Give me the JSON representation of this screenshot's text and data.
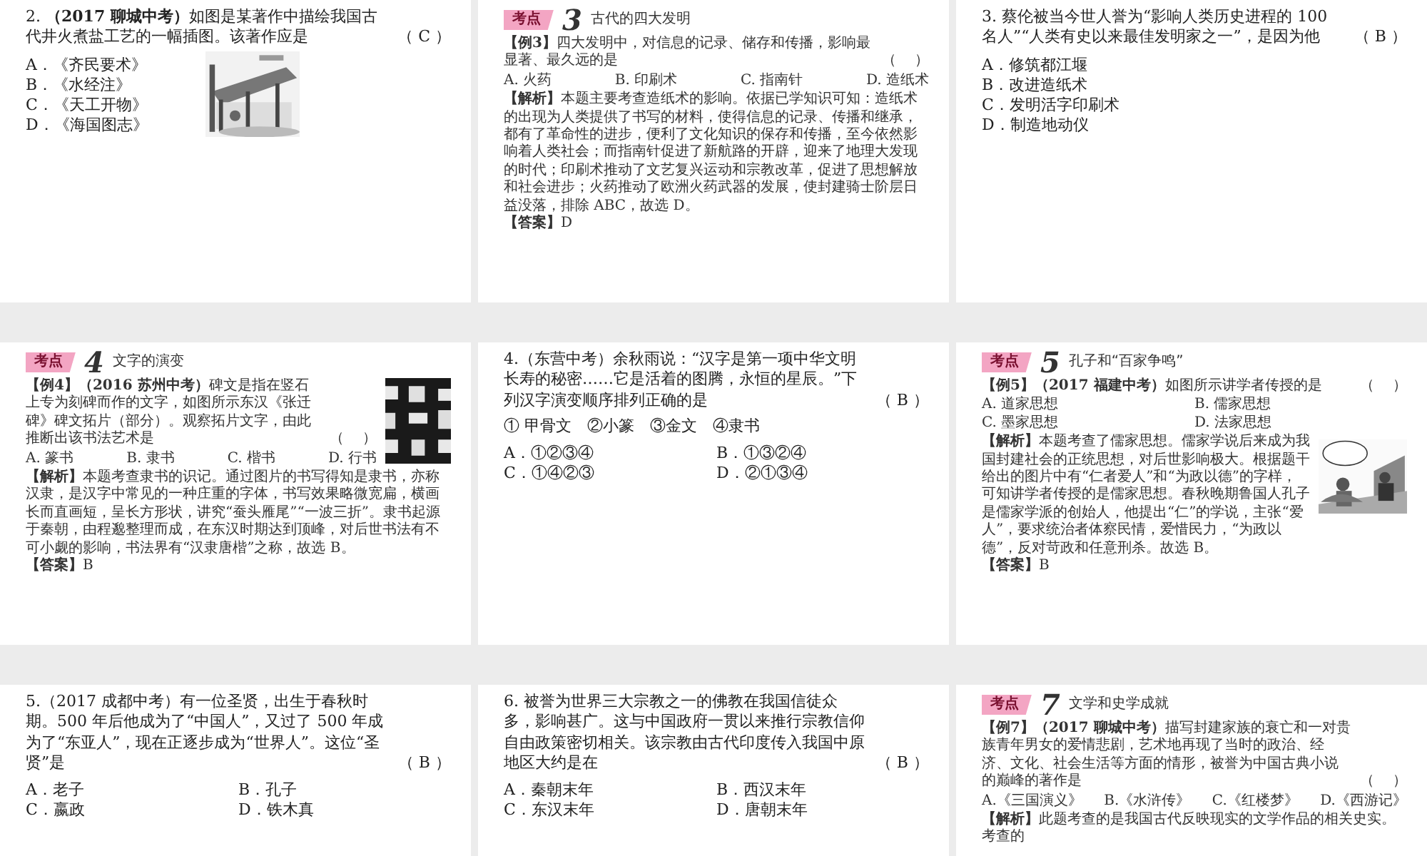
{
  "slides": [
    {
      "kind": "question",
      "selected": false,
      "stem": "2. **（2017 聊城中考）**如图是某著作中描绘我国古代井火煮盐工艺的一幅插图。该著作应是",
      "blank": "（ C ）",
      "options": [
        "A．《齐民要术》",
        "B．《水经注》",
        "C．《天工开物》",
        "D．《海国图志》"
      ]
    },
    {
      "kind": "example",
      "selected": false,
      "topic_label": "考点",
      "topic_number": "3",
      "topic_title": "古代的四大发明",
      "question": "**【例3】**四大发明中，对信息的记录、储存和传播，影响最显著、最久远的是",
      "blank": "（　 ）",
      "options_inline": true,
      "options": [
        "A. 火药",
        "B. 印刷术",
        "C. 指南针",
        "D. 造纸术"
      ],
      "analysis": "**【解析】**本题主要考查造纸术的影响。依据已学知识可知：造纸术的出现为人类提供了书写的材料，使得信息的记录、传播和继承，都有了革命性的进步，便利了文化知识的保存和传播，至今依然影响着人类社会；而指南针促进了新航路的开辟，迎来了地理大发现的时代；印刷术推动了文艺复兴运动和宗教改革，促进了思想解放和社会进步；火药推动了欧洲火药武器的发展，使封建骑士阶层日益没落，排除 ABC，故选 D。",
      "answer": "**【答案】**D"
    },
    {
      "kind": "question",
      "selected": false,
      "stem": "3. 蔡伦被当今世人誉为“影响人类历史进程的 100 名人”“人类有史以来最佳发明家之一”，是因为他",
      "blank": "（ B ）",
      "options": [
        "A．修筑都江堰",
        "B．改进造纸术",
        "C．发明活字印刷术",
        "D．制造地动仪"
      ]
    },
    {
      "kind": "example",
      "selected": false,
      "topic_label": "考点",
      "topic_number": "4",
      "topic_title": "文字的演变",
      "question": "**【例4】（2016 苏州中考）**碑文是指在竖石上专为刻碑而作的文字，如图所示东汉《张迁碑》碑文拓片（部分）。观察拓片文字，由此推断出该书法艺术是",
      "blank": "（　 ）",
      "options_inline": true,
      "options": [
        "A. 篆书",
        "B. 隶书",
        "C. 楷书",
        "D. 行书"
      ],
      "analysis": "**【解析】**本题考查隶书的识记。通过图片的书写得知是隶书，亦称汉隶，是汉字中常见的一种庄重的字体，书写效果略微宽扁，横画长而直画短，呈长方形状，讲究“蚕头雁尾”“一波三折”。隶书起源于秦朝，由程邈整理而成，在东汉时期达到顶峰，对后世书法有不可小觑的影响，书法界有“汉隶唐楷”之称，故选 B。",
      "answer": "**【答案】**B"
    },
    {
      "kind": "question",
      "selected": false,
      "stem": "4.（东营中考）余秋雨说：“汉字是第一项中华文明长寿的秘密……它是活着的图腾，永恒的星辰。”下列汉字演变顺序排列正确的是",
      "blank": "（ B ）",
      "extra": "① 甲骨文　②小篆　③金文　④隶书",
      "options_paired": true,
      "options": [
        "A．①②③④",
        "B．①③②④",
        "C．①④②③",
        "D．②①③④"
      ]
    },
    {
      "kind": "example",
      "selected": false,
      "topic_label": "考点",
      "topic_number": "5",
      "topic_title": "孔子和“百家争鸣”",
      "question": "**【例5】（2017 福建中考）**如图所示讲学者传授的是",
      "blank": "（　 ）",
      "options_paired": true,
      "options": [
        "A. 道家思想",
        "B. 儒家思想",
        "C. 墨家思想",
        "D. 法家思想"
      ],
      "analysis": "**【解析】**本题考查了儒家思想。儒家学说后来成为我国封建社会的正统思想，对后世影响极大。根据题干给出的图片中有“仁者爱人”和“为政以德”的字样，可知讲学者传授的是儒家思想。春秋晚期鲁国人孔子是儒家学派的创始人，他提出“仁”的学说，主张“爱人”，要求统治者体察民情，爱惜民力，“为政以德”，反对苛政和任意刑杀。故选 B。",
      "answer": "**【答案】**B"
    },
    {
      "kind": "question",
      "selected": false,
      "stem": "5.（2017 成都中考）有一位圣贤，出生于春秋时期。500 年后他成为了“中国人”，又过了 500 年成为了“东亚人”，现在正逐步成为“世界人”。这位“圣贤”是",
      "blank": "（ B ）",
      "options_paired": true,
      "options": [
        "A．老子",
        "B．孔子",
        "C．嬴政",
        "D．铁木真"
      ]
    },
    {
      "kind": "question",
      "selected": false,
      "stem": "6. 被誉为世界三大宗教之一的佛教在我国信徒众多，影响甚广。这与中国政府一贯以来推行宗教信仰自由政策密切相关。该宗教由古代印度传入我国中原地区大约是在",
      "blank": "（ B ）",
      "options_paired": true,
      "options": [
        "A．秦朝末年",
        "B．西汉末年",
        "C．东汉末年",
        "D．唐朝末年"
      ]
    },
    {
      "kind": "example",
      "selected": false,
      "topic_label": "考点",
      "topic_number": "7",
      "topic_title": "文学和史学成就",
      "question": "**【例7】（2017 聊城中考）**描写封建家族的衰亡和一对贵族青年男女的爱情悲剧，艺术地再现了当时的政治、经济、文化、社会生活等方面的情形，被誉为中国古典小说的巅峰的著作是",
      "blank": "（　 ）",
      "options_inline": true,
      "options": [
        "A.《三国演义》",
        "B.《水浒传》",
        "C.《红楼梦》",
        "D.《西游记》"
      ],
      "analysis": "**【解析】**此题考查的是我国古代反映现实的文学作品的相关史实。考查的"
    }
  ]
}
